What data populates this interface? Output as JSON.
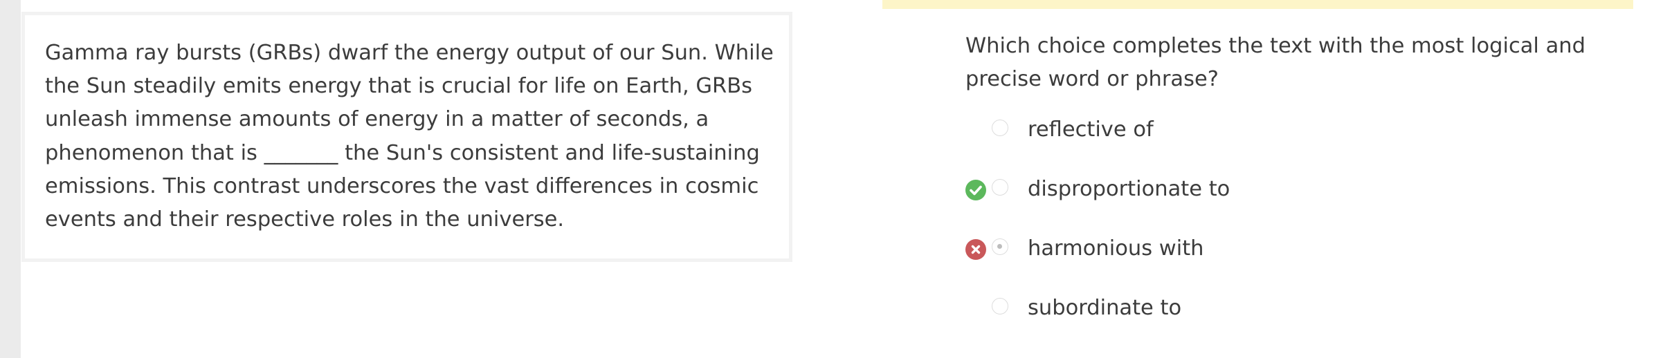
{
  "passage": {
    "text": "Gamma ray bursts (GRBs) dwarf the energy output of our Sun. While the Sun steadily emits energy that is crucial for life on Earth, GRBs unleash immense amounts of energy in a matter of seconds, a phenomenon that is _______ the Sun's consistent and life-sustaining emissions. This contrast underscores the vast differences in cosmic events and their respective roles in the universe."
  },
  "question": {
    "prompt": "Which choice completes the text with the most logical and precise word or phrase?"
  },
  "choices": [
    {
      "label": "reflective of",
      "status": "none",
      "selected": false
    },
    {
      "label": "disproportionate to",
      "status": "correct",
      "selected": false,
      "status_icon": "check-circle-icon",
      "status_color": "#5cb85c"
    },
    {
      "label": "harmonious with",
      "status": "incorrect",
      "selected": true,
      "status_icon": "x-circle-icon",
      "status_color": "#c9585a"
    },
    {
      "label": "subordinate to",
      "status": "none",
      "selected": false
    }
  ],
  "colors": {
    "highlight": "#fdf5c8",
    "correct": "#5cb85c",
    "incorrect": "#c9585a",
    "text": "#3c3c3c"
  }
}
